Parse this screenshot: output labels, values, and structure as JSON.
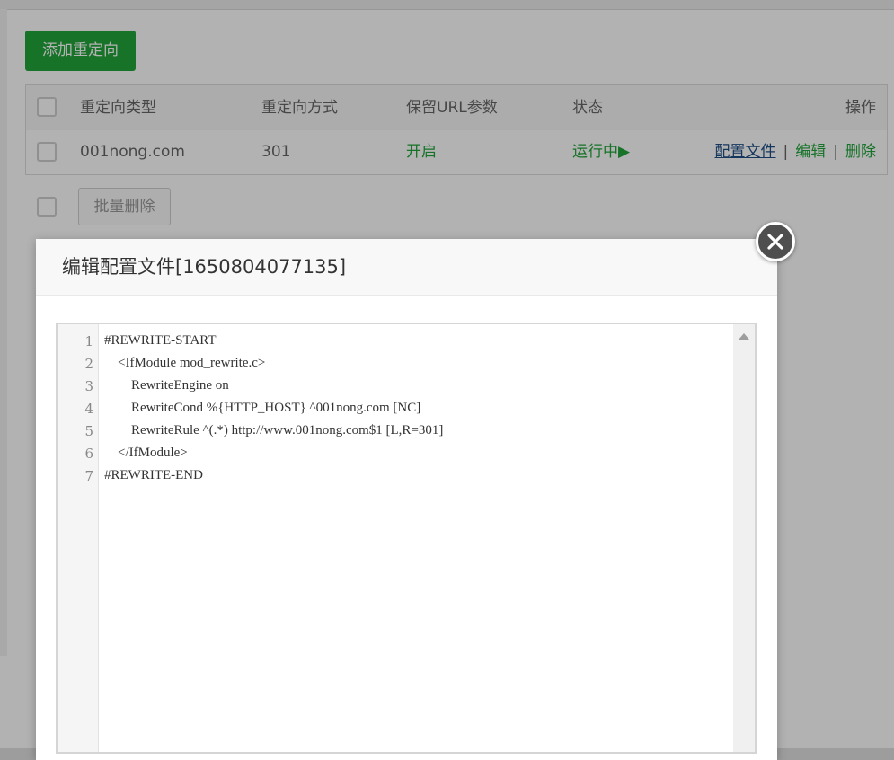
{
  "toolbar": {
    "add_redirect_label": "添加重定向"
  },
  "table": {
    "headers": {
      "type": "重定向类型",
      "method": "重定向方式",
      "keep_params": "保留URL参数",
      "status": "状态",
      "actions": "操作"
    },
    "rows": [
      {
        "type": "001nong.com",
        "method": "301",
        "keep_params": "开启",
        "status": "运行中▶",
        "actions": {
          "config": "配置文件",
          "edit": "编辑",
          "delete": "删除",
          "separator": "|"
        }
      }
    ]
  },
  "batch": {
    "delete_label": "批量删除"
  },
  "modal": {
    "title": "编辑配置文件[1650804077135]",
    "close_icon": "close-icon"
  },
  "editor": {
    "lines": [
      {
        "n": "1",
        "text": "#REWRITE-START"
      },
      {
        "n": "2",
        "text": "    <IfModule mod_rewrite.c>"
      },
      {
        "n": "3",
        "text": "        RewriteEngine on"
      },
      {
        "n": "4",
        "text": "        RewriteCond %{HTTP_HOST} ^001nong.com [NC]"
      },
      {
        "n": "5",
        "text": "        RewriteRule ^(.*) http://www.001nong.com$1 [L,R=301]"
      },
      {
        "n": "6",
        "text": "    </IfModule>"
      },
      {
        "n": "7",
        "text": "#REWRITE-END"
      }
    ]
  },
  "colors": {
    "accent": "#20a53a",
    "link": "#1f4f86",
    "overlay": "rgba(0,0,0,0.30)"
  }
}
